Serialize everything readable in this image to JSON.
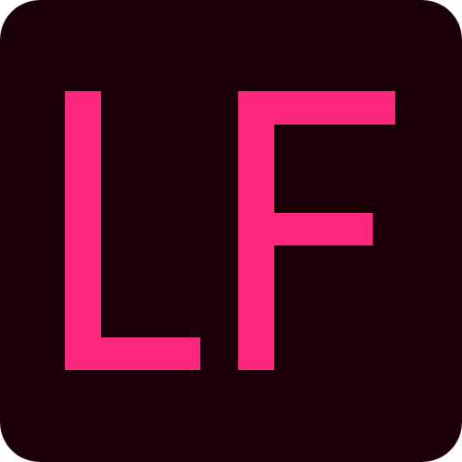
{
  "icon": {
    "initials": "LF",
    "colors": {
      "background": "#1c0008",
      "letters": "#fd287d"
    }
  }
}
